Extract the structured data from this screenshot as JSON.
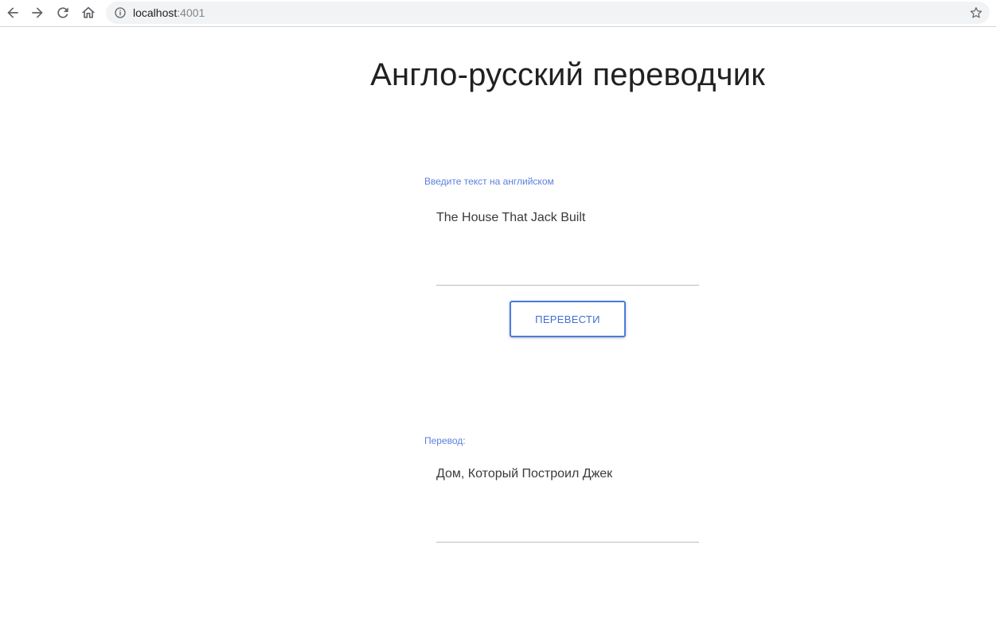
{
  "browser": {
    "url_host": "localhost",
    "url_port": ":4001"
  },
  "page": {
    "title": "Англо-русский переводчик"
  },
  "input_section": {
    "label": "Введите текст на английском",
    "value": "The House That Jack Built"
  },
  "action": {
    "translate_label": "ПЕРЕВЕСТИ"
  },
  "output_section": {
    "label": "Перевод:",
    "value": "Дом, Который Построил Джек"
  },
  "colors": {
    "accent": "#4a7be0",
    "label": "#5b7fdc",
    "text": "#3a3a3a"
  },
  "icons": [
    "back-arrow-icon",
    "forward-arrow-icon",
    "reload-icon",
    "home-icon",
    "info-icon",
    "star-icon"
  ]
}
